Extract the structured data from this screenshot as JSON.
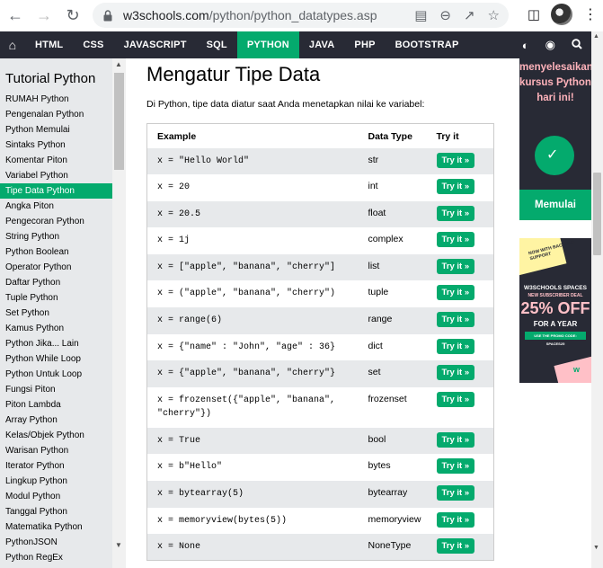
{
  "browser": {
    "url_host": "w3schools.com",
    "url_path": "/python/python_datatypes.asp"
  },
  "topnav": {
    "items": [
      "HTML",
      "CSS",
      "JAVASCRIPT",
      "SQL",
      "PYTHON",
      "JAVA",
      "PHP",
      "BOOTSTRAP"
    ],
    "active": "PYTHON"
  },
  "sidebar": {
    "title": "Tutorial Python",
    "items": [
      "RUMAH Python",
      "Pengenalan Python",
      "Python Memulai",
      "Sintaks Python",
      "Komentar Piton",
      "Variabel Python",
      "Tipe Data Python",
      "Angka Piton",
      "Pengecoran Python",
      "String Python",
      "Python Boolean",
      "Operator Python",
      "Daftar Python",
      "Tuple Python",
      "Set Python",
      "Kamus Python",
      "Python Jika... Lain",
      "Python While Loop",
      "Python Untuk Loop",
      "Fungsi Piton",
      "Piton Lambda",
      "Array Python",
      "Kelas/Objek Python",
      "Warisan Python",
      "Iterator Python",
      "Lingkup Python",
      "Modul Python",
      "Tanggal Python",
      "Matematika Python",
      "PythonJSON",
      "Python RegEx"
    ],
    "active_index": 6
  },
  "main": {
    "heading": "Mengatur Tipe Data",
    "intro": "Di Python, tipe data diatur saat Anda menetapkan nilai ke variabel:",
    "table": {
      "headers": [
        "Example",
        "Data Type",
        "Try it"
      ],
      "try_label": "Try it »",
      "rows": [
        {
          "code": "x = \"Hello World\"",
          "type": "str"
        },
        {
          "code": "x = 20",
          "type": "int"
        },
        {
          "code": "x = 20.5",
          "type": "float"
        },
        {
          "code": "x = 1j",
          "type": "complex"
        },
        {
          "code": "x = [\"apple\", \"banana\", \"cherry\"]",
          "type": "list"
        },
        {
          "code": "x = (\"apple\", \"banana\", \"cherry\")",
          "type": "tuple"
        },
        {
          "code": "x = range(6)",
          "type": "range"
        },
        {
          "code": "x = {\"name\" : \"John\", \"age\" : 36}",
          "type": "dict"
        },
        {
          "code": "x = {\"apple\", \"banana\", \"cherry\"}",
          "type": "set"
        },
        {
          "code": "x = frozenset({\"apple\", \"banana\", \"cherry\"})",
          "type": "frozenset"
        },
        {
          "code": "x = True",
          "type": "bool"
        },
        {
          "code": "x = b\"Hello\"",
          "type": "bytes"
        },
        {
          "code": "x = bytearray(5)",
          "type": "bytearray"
        },
        {
          "code": "x = memoryview(bytes(5))",
          "type": "memoryview"
        },
        {
          "code": "x = None",
          "type": "NoneType"
        }
      ]
    }
  },
  "ads": {
    "ad1_text": "menyelesaikan kursus Python hari ini!",
    "ad1_button": "Memulai",
    "ad2_small": "NOW WITH BACKEND SUPPORT",
    "ad2_title": "W3SCHOOLS SPACES",
    "ad2_subtitle": "NEW SUBSCRIBER DEAL",
    "ad2_discount": "25% OFF",
    "ad2_period": "FOR A YEAR",
    "ad2_promo": "USE THE PROMO CODE: SPACES25"
  },
  "colors": {
    "nav_bg": "#282a35",
    "accent": "#04aa6d",
    "sidebar_bg": "#e7e9eb"
  }
}
